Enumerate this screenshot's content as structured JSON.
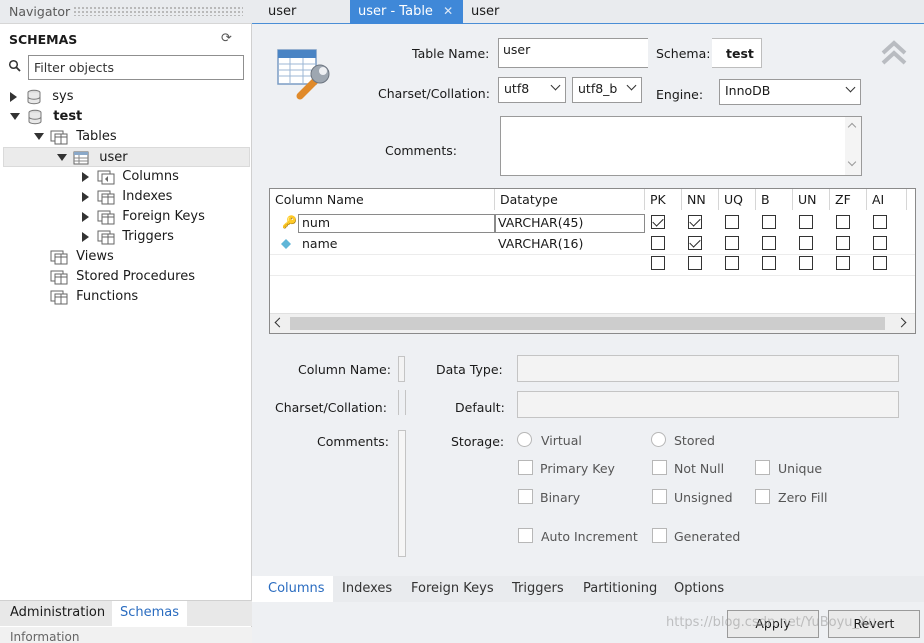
{
  "navigator": {
    "header": "Navigator",
    "schemas_title": "SCHEMAS",
    "filter_placeholder": "Filter objects",
    "tree": {
      "sys": "sys",
      "test": "test",
      "tables": "Tables",
      "user": "user",
      "columns": "Columns",
      "indexes": "Indexes",
      "foreign_keys": "Foreign Keys",
      "triggers": "Triggers",
      "views": "Views",
      "stored_procedures": "Stored Procedures",
      "functions": "Functions"
    },
    "bottom_tabs": [
      "Administration",
      "Schemas"
    ],
    "info_header": "Information"
  },
  "tabs": [
    "user",
    "user - Table",
    "user"
  ],
  "editor": {
    "table_name_label": "Table Name:",
    "table_name_value": "user",
    "schema_label": "Schema:",
    "schema_value": "test",
    "charset_label": "Charset/Collation:",
    "charset_value": "utf8",
    "collation_value": "utf8_b",
    "engine_label": "Engine:",
    "engine_value": "InnoDB",
    "comments_label": "Comments:"
  },
  "grid": {
    "headers": [
      "Column Name",
      "Datatype",
      "PK",
      "NN",
      "UQ",
      "B",
      "UN",
      "ZF",
      "AI"
    ],
    "rows": [
      {
        "name": "num",
        "type": "VARCHAR(45)",
        "flags": [
          true,
          true,
          false,
          false,
          false,
          false,
          false
        ]
      },
      {
        "name": "name",
        "type": "VARCHAR(16)",
        "flags": [
          false,
          true,
          false,
          false,
          false,
          false,
          false
        ]
      },
      {
        "name": "",
        "type": "",
        "flags": [
          false,
          false,
          false,
          false,
          false,
          false,
          false
        ]
      }
    ]
  },
  "details": {
    "column_name_label": "Column Name:",
    "data_type_label": "Data Type:",
    "charset_label": "Charset/Collation:",
    "default_label": "Default:",
    "comments_label": "Comments:",
    "storage_label": "Storage:",
    "virtual": "Virtual",
    "stored": "Stored",
    "primary_key": "Primary Key",
    "not_null": "Not Null",
    "unique": "Unique",
    "binary": "Binary",
    "unsigned": "Unsigned",
    "zero_fill": "Zero Fill",
    "auto_increment": "Auto Increment",
    "generated": "Generated"
  },
  "bottom_tabs": [
    "Columns",
    "Indexes",
    "Foreign Keys",
    "Triggers",
    "Partitioning",
    "Options"
  ],
  "buttons": {
    "apply": "Apply",
    "revert": "Revert"
  },
  "watermark": "https://blog.csdn.net/YuBoyu_Xu",
  "colors": {
    "accent": "#3f88d8",
    "active_tab_text": "#2a6cc0"
  }
}
